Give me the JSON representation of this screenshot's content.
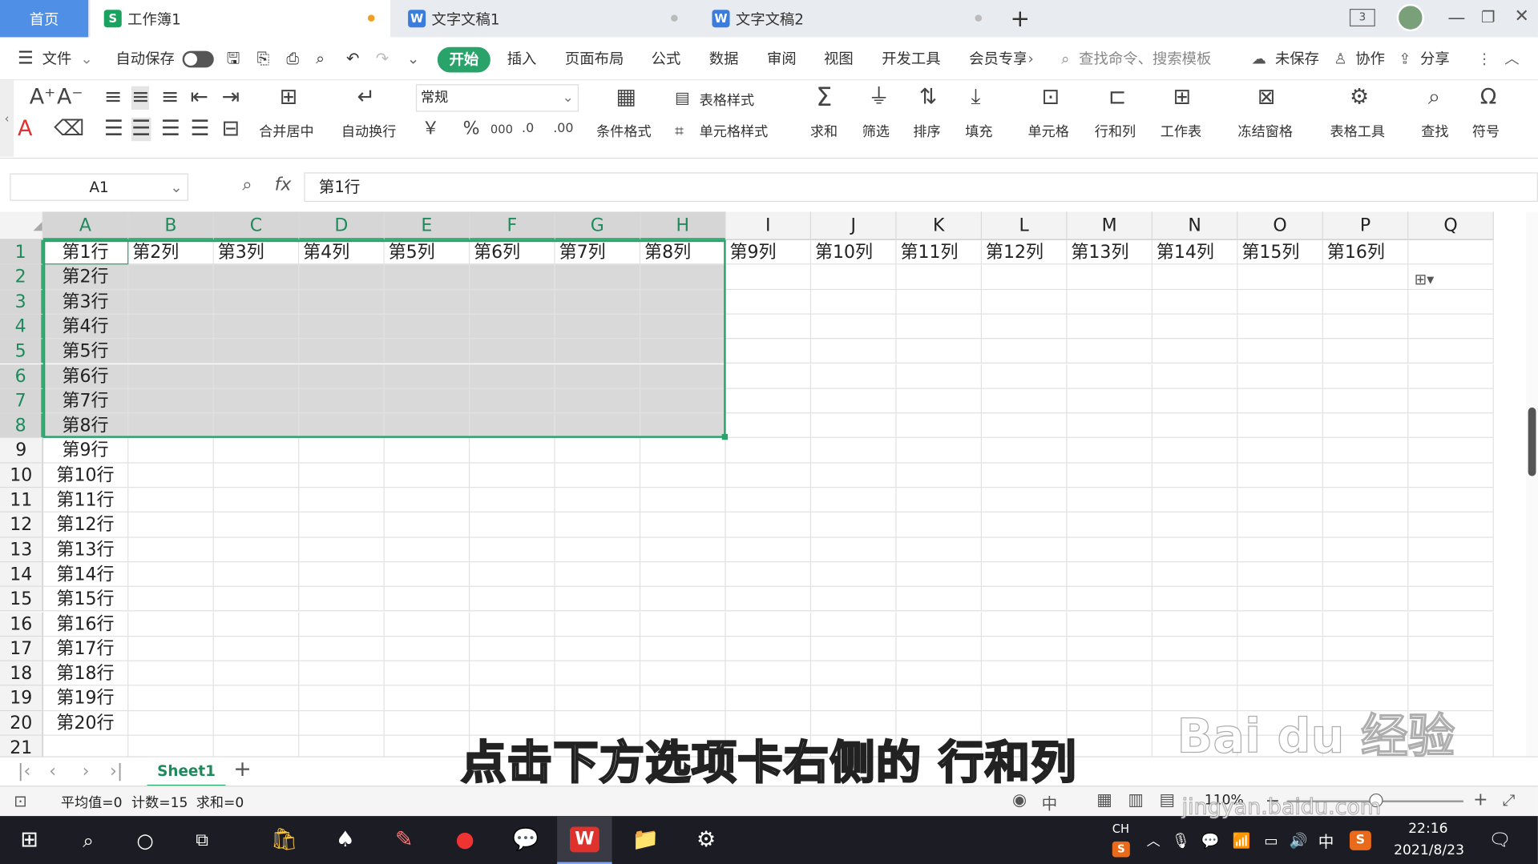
{
  "tabs": {
    "home": "首页",
    "t1": "工作簿1",
    "t2": "文字文稿1",
    "t3": "文字文稿2",
    "plus": "+",
    "badge": "3"
  },
  "menu": {
    "file": "文件",
    "autosave": "自动保存",
    "start": "开始",
    "insert": "插入",
    "layout": "页面布局",
    "formula": "公式",
    "data": "数据",
    "review": "审阅",
    "view": "视图",
    "dev": "开发工具",
    "member": "会员专享",
    "search": "查找命令、搜索模板",
    "unsaved": "未保存",
    "collab": "协作",
    "share": "分享"
  },
  "toolbar": {
    "merge": "合并居中",
    "wrap": "自动换行",
    "format": "常规",
    "cond": "条件格式",
    "tablestyle": "表格样式",
    "cellstyle": "单元格样式",
    "sum": "求和",
    "filter": "筛选",
    "sort": "排序",
    "fill": "填充",
    "cells": "单元格",
    "rowcol": "行和列",
    "sheet": "工作表",
    "freeze": "冻结窗格",
    "tools": "表格工具",
    "find": "查找",
    "symbol": "符号",
    "currency": "￥",
    "percent": "%",
    "thousands": "000"
  },
  "formula": {
    "namebox": "A1",
    "fx": "fx",
    "value": "第1行"
  },
  "columns": [
    "A",
    "B",
    "C",
    "D",
    "E",
    "F",
    "G",
    "H",
    "I",
    "J",
    "K",
    "L",
    "M",
    "N",
    "O",
    "P",
    "Q"
  ],
  "row1": [
    "第1行",
    "第2列",
    "第3列",
    "第4列",
    "第5列",
    "第6列",
    "第7列",
    "第8列",
    "第9列",
    "第10列",
    "第11列",
    "第12列",
    "第13列",
    "第14列",
    "第15列",
    "第16列"
  ],
  "colA": [
    "第2行",
    "第3行",
    "第4行",
    "第5行",
    "第6行",
    "第7行",
    "第8行",
    "第9行",
    "第10行",
    "第11行",
    "第12行",
    "第13行",
    "第14行",
    "第15行",
    "第16行",
    "第17行",
    "第18行",
    "第19行",
    "第20行"
  ],
  "sheets": {
    "active": "Sheet1",
    "add": "+"
  },
  "status": {
    "avg": "平均值=0",
    "count": "计数=15",
    "sum": "求和=0",
    "zoom": "110%"
  },
  "subtitle": "点击下方选项卡右侧的 行和列",
  "watermark": {
    "brand": "Bai du 经验",
    "url": "jingyan.baidu.com"
  },
  "taskbar": {
    "lang": "CH",
    "ime": "中",
    "time": "22:16",
    "date": "2021/8/23"
  },
  "colors": {
    "accent": "#2aa36b",
    "tabHome": "#4f8fe6",
    "selection": "#d9d9d9"
  }
}
